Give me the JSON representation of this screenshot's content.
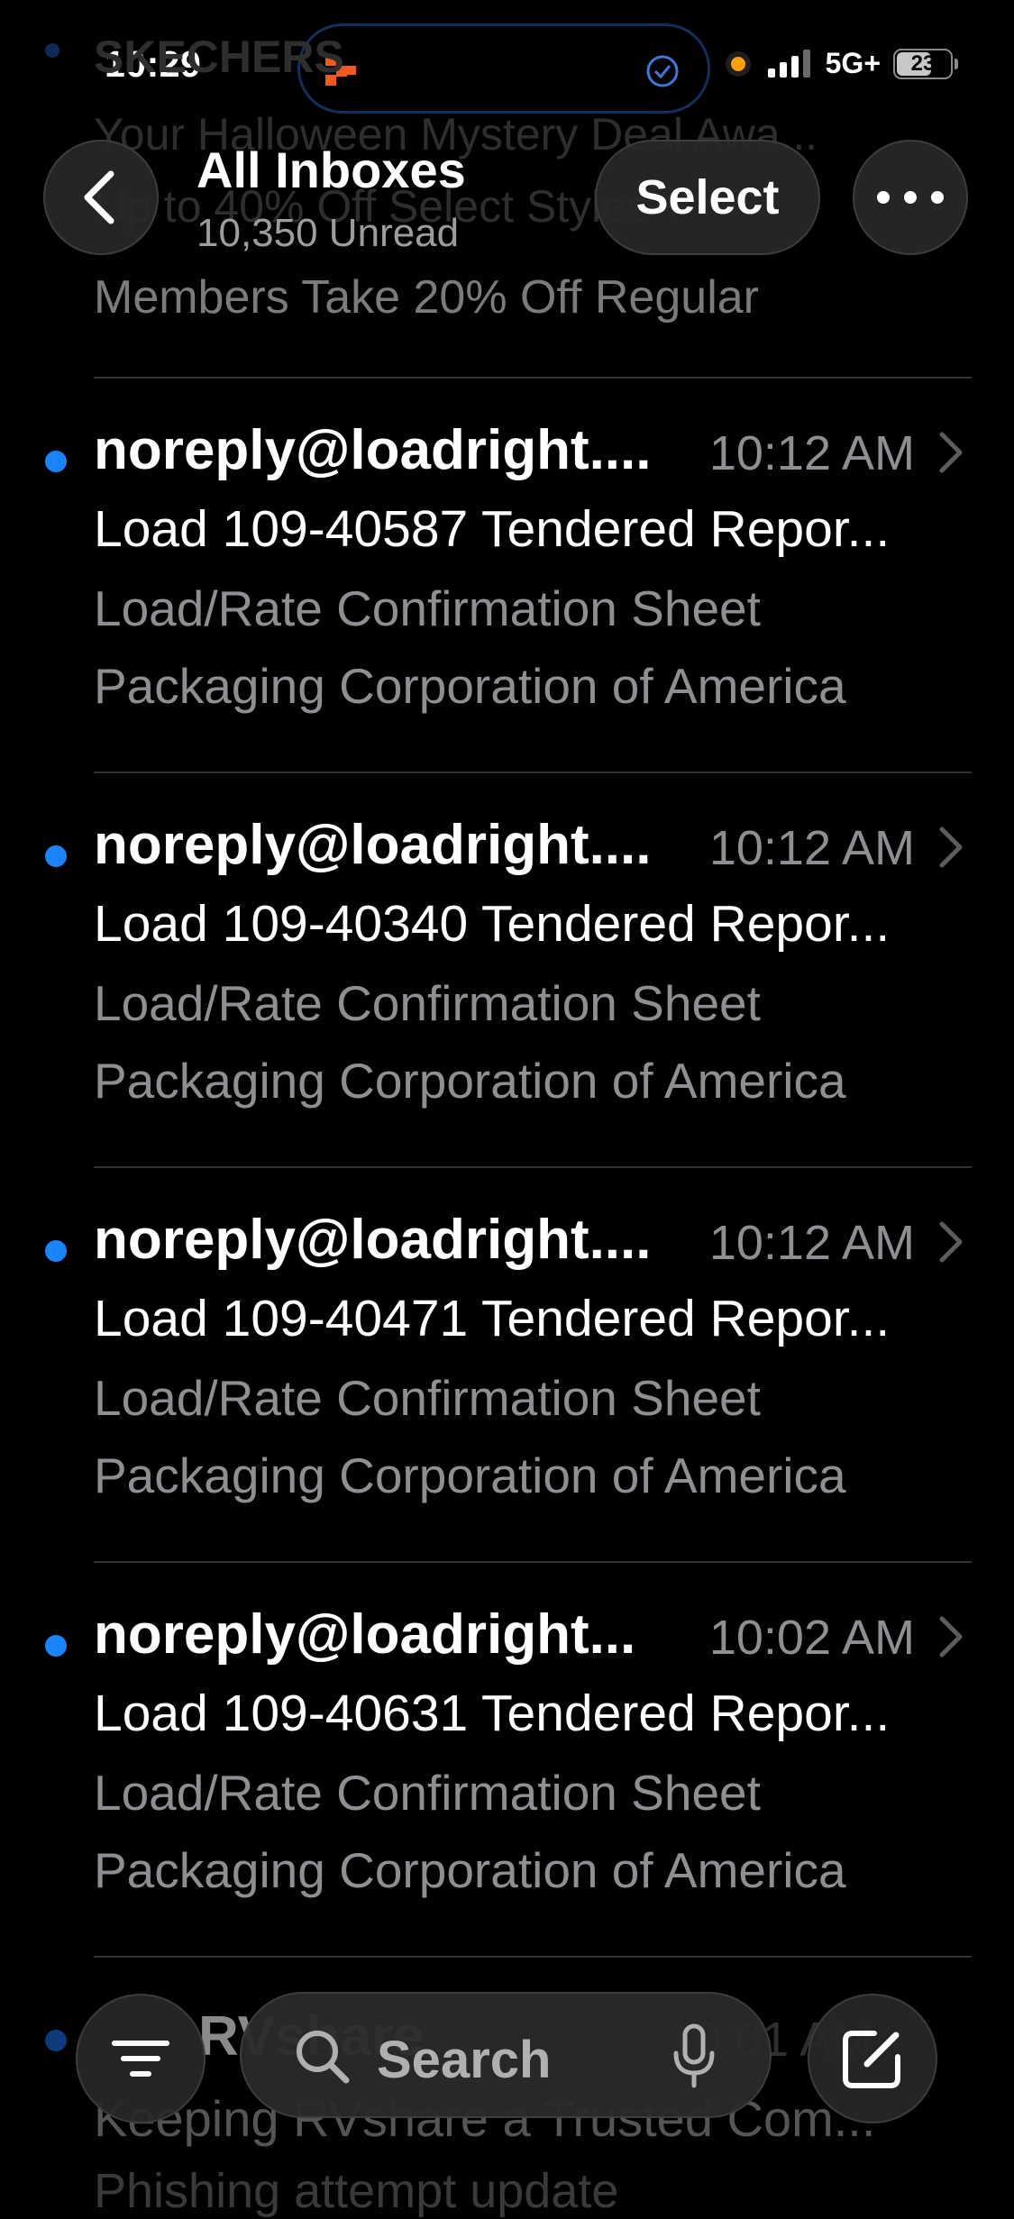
{
  "status": {
    "time": "10:29",
    "network": "5G+",
    "battery": "23"
  },
  "behind_header": {
    "line1": "SKECHERS",
    "line2": "Your Halloween Mystery Deal Awa...",
    "line3": "Up to 40% Off Select Styles +",
    "partial_preview": "Members Take 20% Off Regular"
  },
  "header": {
    "title": "All Inboxes",
    "subtitle": "10,350 Unread",
    "select_label": "Select"
  },
  "messages": [
    {
      "sender": "noreply@loadright....",
      "time": "10:12 AM",
      "subject": "Load 109-40587 Tendered Repor...",
      "preview": [
        "Load/Rate Confirmation Sheet",
        "Packaging Corporation of America"
      ]
    },
    {
      "sender": "noreply@loadright....",
      "time": "10:12 AM",
      "subject": "Load 109-40340 Tendered Repor...",
      "preview": [
        "Load/Rate Confirmation Sheet",
        "Packaging Corporation of America"
      ]
    },
    {
      "sender": "noreply@loadright....",
      "time": "10:12 AM",
      "subject": "Load 109-40471 Tendered Repor...",
      "preview": [
        "Load/Rate Confirmation Sheet",
        "Packaging Corporation of America"
      ]
    },
    {
      "sender": "noreply@loadright...",
      "time": "10:02 AM",
      "subject": "Load 109-40631 Tendered Repor...",
      "preview": [
        "Load/Rate Confirmation Sheet",
        "Packaging Corporation of America"
      ]
    }
  ],
  "behind_toolbar": {
    "sender_partial": "RVshare",
    "time_partial": "10:01 AM",
    "subject_partial": "Keeping RVshare a Trusted Com...",
    "preview_partial": "Phishing attempt update"
  },
  "toolbar": {
    "search_placeholder": "Search"
  },
  "colors": {
    "unread_dot": "#1a84ff",
    "background": "#000000",
    "secondary_text": "#8e8e93"
  }
}
